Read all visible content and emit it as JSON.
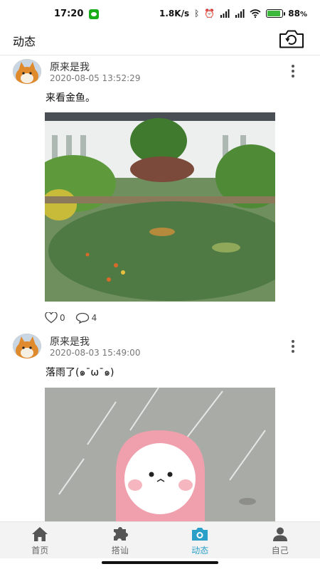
{
  "status_bar": {
    "time": "17:20",
    "network_speed": "1.8K/s",
    "battery_percent": "88",
    "battery_suffix": "%",
    "battery_level": 0.88,
    "icons": [
      "wechat-icon",
      "bluetooth-icon",
      "alarm-icon",
      "signal-hd-icon",
      "signal-hd-icon",
      "wifi-icon",
      "battery-icon"
    ]
  },
  "header": {
    "title": "动态",
    "action_icon": "camera-icon"
  },
  "posts": [
    {
      "username": "原来是我",
      "time": "2020-08-05 13:52:29",
      "text": "来看金鱼。",
      "likes": "0",
      "comments": "4",
      "image": "garden pond with goldfish"
    },
    {
      "username": "原来是我",
      "time": "2020-08-03 15:49:00",
      "text": "落雨了(๑¯ω¯๑)",
      "image": "cartoon character in pink raincoat in rain"
    }
  ],
  "tabbar": {
    "tabs": [
      {
        "label": "首页",
        "icon": "home-icon",
        "active": false
      },
      {
        "label": "搭讪",
        "icon": "puzzle-icon",
        "active": false
      },
      {
        "label": "动态",
        "icon": "camera-icon",
        "active": true
      },
      {
        "label": "自己",
        "icon": "user-icon",
        "active": false
      }
    ]
  },
  "colors": {
    "accent": "#2aa0c8",
    "tab_inactive": "#666666",
    "tabbar_bg": "#f3f3f3"
  }
}
